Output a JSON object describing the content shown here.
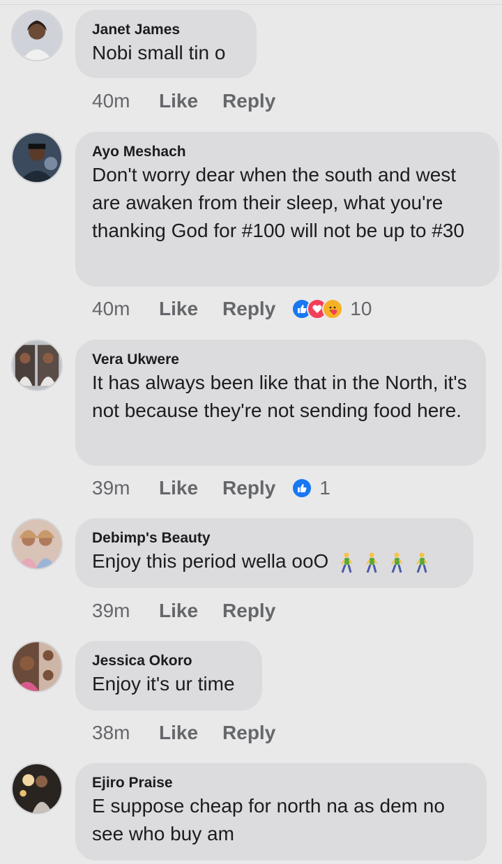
{
  "comments": [
    {
      "author": "Janet James",
      "text": "Nobi small tin o",
      "time": "40m",
      "like": "Like",
      "reply": "Reply"
    },
    {
      "author": "Ayo Meshach",
      "text": "Don't worry dear when the south and west are awaken from their sleep, what you're thanking God for #100 will not be up to #30",
      "time": "40m",
      "like": "Like",
      "reply": "Reply",
      "reactions": {
        "icons": [
          "like-icon",
          "love-icon",
          "care-icon"
        ],
        "count": "10"
      }
    },
    {
      "author": "Vera Ukwere",
      "text": "It has always been like that in the North, it's not because they're not sending food here.",
      "time": "39m",
      "like": "Like",
      "reply": "Reply",
      "reactions": {
        "icons": [
          "like-icon"
        ],
        "count": "1"
      }
    },
    {
      "author": "Debimp's Beauty",
      "text": "Enjoy this period wella ooO",
      "emojis": [
        "walking-person-emoji",
        "walking-person-emoji",
        "walking-person-emoji",
        "walking-person-emoji"
      ],
      "time": "39m",
      "like": "Like",
      "reply": "Reply"
    },
    {
      "author": "Jessica Okoro",
      "text": "Enjoy it's ur time",
      "time": "38m",
      "like": "Like",
      "reply": "Reply"
    },
    {
      "author": "Ejiro Praise",
      "text": "E suppose cheap for north na as dem no see who buy am"
    }
  ],
  "colors": {
    "background": "#e9e9ea",
    "bubble": "#dcdcde",
    "like_blue": "#1877f2",
    "love_red": "#f33e58",
    "care_yellow": "#f7b125"
  }
}
